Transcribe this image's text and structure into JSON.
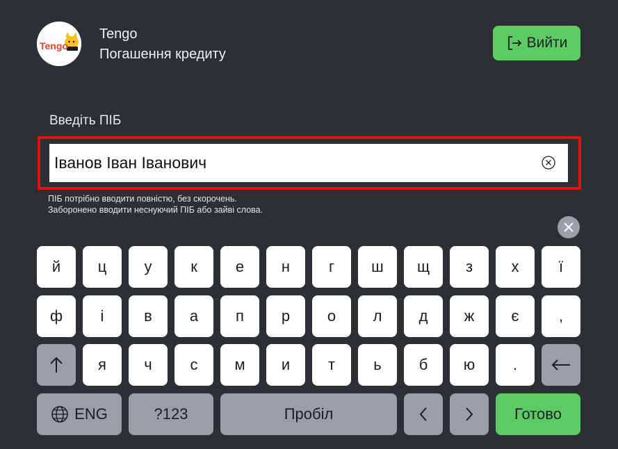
{
  "header": {
    "logo_text": "Tengo",
    "app_name": "Tengo",
    "subtitle": "Погашення кредиту",
    "exit_label": "Вийти",
    "exit_icon": "logout-icon"
  },
  "form": {
    "label": "Введіть ПІБ",
    "value": "Іванов Іван Іванович",
    "clear_icon": "clear-circle-icon",
    "hint_line1": "ПІБ потрібно вводити повністю, без скорочень.",
    "hint_line2": "Заборонено вводити неснуючий ПІБ або зайві слова.",
    "highlight_color": "#e20f13"
  },
  "keyboard": {
    "close_icon": "close-icon",
    "row1": [
      "й",
      "ц",
      "у",
      "к",
      "е",
      "н",
      "г",
      "ш",
      "щ",
      "з",
      "х",
      "ї"
    ],
    "row2": [
      "ф",
      "і",
      "в",
      "а",
      "п",
      "р",
      "о",
      "л",
      "д",
      "ж",
      "є",
      ","
    ],
    "row3": [
      "я",
      "ч",
      "с",
      "м",
      "и",
      "т",
      "ь",
      "б",
      "ю",
      "."
    ],
    "shift_icon": "shift-arrow-up-icon",
    "backspace_icon": "backspace-arrow-left-icon",
    "lang_icon": "globe-icon",
    "lang_label": "ENG",
    "symbols_label": "?123",
    "space_label": "Пробіл",
    "left_icon": "chevron-left-icon",
    "right_icon": "chevron-right-icon",
    "done_label": "Готово"
  },
  "colors": {
    "background": "#2c3035",
    "accent_green": "#5bcb63",
    "key_white": "#ffffff",
    "key_gray": "#999ea7"
  }
}
